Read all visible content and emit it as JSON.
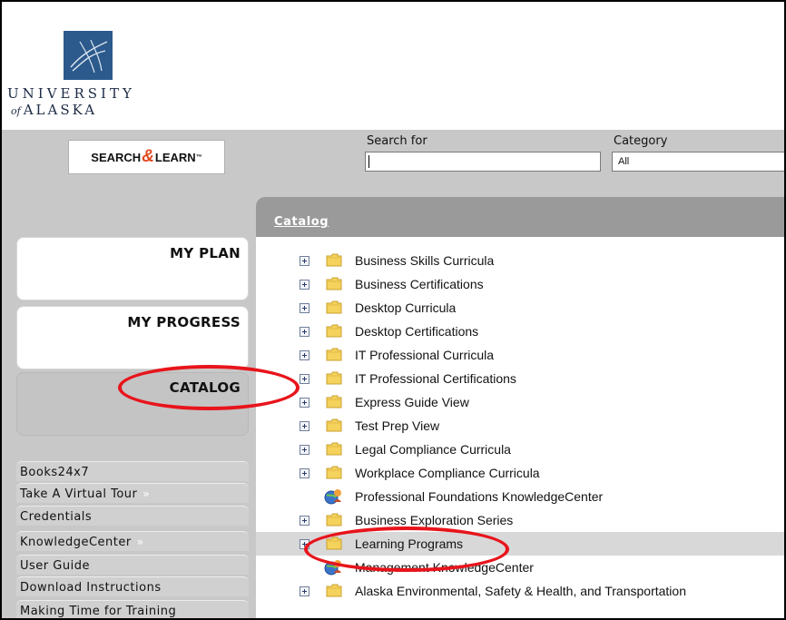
{
  "logo": {
    "line1": "UNIVERSITY",
    "line2_prefix": "of",
    "line2": "ALASKA"
  },
  "search_learn": {
    "part1": "SEARCH",
    "amp": "&",
    "part2": "LEARN",
    "tm": "™"
  },
  "search": {
    "label": "Search for",
    "value": "",
    "category_label": "Category",
    "category_value": "All"
  },
  "nav": {
    "my_plan": "MY PLAN",
    "my_progress": "MY PROGRESS",
    "catalog": "CATALOG"
  },
  "tools": [
    {
      "label": "Books24x7",
      "ext": ""
    },
    {
      "label": "Take A Virtual Tour",
      "ext": "»"
    },
    {
      "label": "Credentials",
      "ext": ""
    },
    {
      "label": "KnowledgeCenter",
      "ext": "»"
    },
    {
      "label": "User Guide",
      "ext": ""
    },
    {
      "label": "Download Instructions",
      "ext": ""
    },
    {
      "label": "Making Time for Training",
      "ext": ""
    }
  ],
  "catalog": {
    "title": "Catalog",
    "items": [
      {
        "label": "Business Skills Curricula",
        "icon": "folder",
        "expandable": true
      },
      {
        "label": "Business Certifications",
        "icon": "folder",
        "expandable": true
      },
      {
        "label": "Desktop Curricula",
        "icon": "folder",
        "expandable": true
      },
      {
        "label": "Desktop Certifications",
        "icon": "folder",
        "expandable": true
      },
      {
        "label": "IT Professional Curricula",
        "icon": "folder",
        "expandable": true
      },
      {
        "label": "IT Professional Certifications",
        "icon": "folder",
        "expandable": true
      },
      {
        "label": "Express Guide View",
        "icon": "folder",
        "expandable": true
      },
      {
        "label": "Test Prep View",
        "icon": "folder",
        "expandable": true
      },
      {
        "label": "Legal Compliance Curricula",
        "icon": "folder",
        "expandable": true
      },
      {
        "label": "Workplace Compliance Curricula",
        "icon": "folder",
        "expandable": true
      },
      {
        "label": "Professional Foundations KnowledgeCenter",
        "icon": "globe",
        "expandable": false
      },
      {
        "label": "Business Exploration Series",
        "icon": "folder",
        "expandable": true
      },
      {
        "label": "Learning Programs",
        "icon": "folder",
        "expandable": true
      },
      {
        "label": "Management KnowledgeCenter",
        "icon": "globe",
        "expandable": false
      },
      {
        "label": "Alaska Environmental, Safety & Health, and Transportation",
        "icon": "folder",
        "expandable": true
      }
    ]
  },
  "colors": {
    "annotation_red": "#e8141b",
    "logo_blue": "#2c5a8c",
    "catalog_header": "#9a9a9a",
    "folder_yellow": "#f5d25c"
  }
}
